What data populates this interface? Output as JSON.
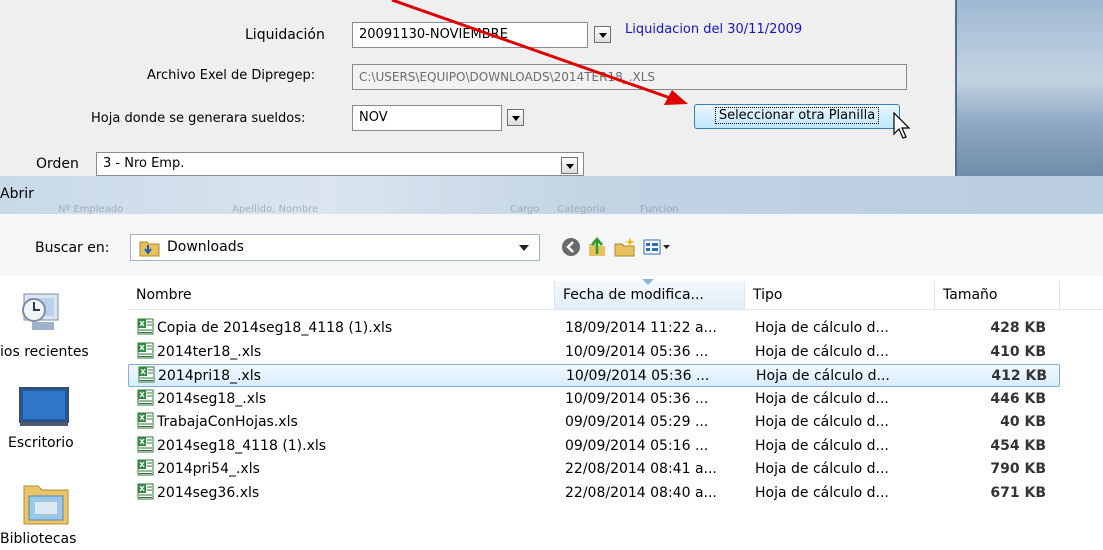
{
  "form": {
    "liquidacion_label": "Liquidación",
    "liquidacion_value": "20091130-NOVIEMBRE",
    "liquidacion_info": "Liquidacion del 30/11/2009",
    "archivo_label": "Archivo Exel de Dipregep:",
    "archivo_value": "C:\\USERS\\EQUIPO\\DOWNLOADS\\2014TER18_.XLS",
    "hoja_label": "Hoja donde se generara sueldos:",
    "hoja_value": "NOV",
    "select_button": "Seleccionar otra Planilla",
    "orden_label": "Orden",
    "orden_value": "3 - Nro Emp."
  },
  "dialog": {
    "title": "Abrir",
    "ghost_headers": [
      "Nº Empleado",
      "Apellido, Nombre",
      "Cargo",
      "Categoria",
      "Funcion"
    ],
    "buscar_label": "Buscar en:",
    "location": "Downloads",
    "places": [
      "ios recientes",
      "Escritorio",
      "Bibliotecas"
    ],
    "columns": [
      "Nombre",
      "Fecha de modifica...",
      "Tipo",
      "Tamaño"
    ],
    "files": [
      {
        "name": "Copia de 2014seg18_4118 (1).xls",
        "date": "18/09/2014 11:22 a...",
        "type": "Hoja de cálculo d...",
        "size": "428 KB"
      },
      {
        "name": "2014ter18_.xls",
        "date": "10/09/2014 05:36 ...",
        "type": "Hoja de cálculo d...",
        "size": "410 KB"
      },
      {
        "name": "2014pri18_.xls",
        "date": "10/09/2014 05:36 ...",
        "type": "Hoja de cálculo d...",
        "size": "412 KB"
      },
      {
        "name": "2014seg18_.xls",
        "date": "10/09/2014 05:36 ...",
        "type": "Hoja de cálculo d...",
        "size": "446 KB"
      },
      {
        "name": "TrabajaConHojas.xls",
        "date": "09/09/2014 05:29 ...",
        "type": "Hoja de cálculo d...",
        "size": "40 KB"
      },
      {
        "name": "2014seg18_4118 (1).xls",
        "date": "09/09/2014 05:16 ...",
        "type": "Hoja de cálculo d...",
        "size": "454 KB"
      },
      {
        "name": "2014pri54_.xls",
        "date": "22/08/2014 08:41 a...",
        "type": "Hoja de cálculo d...",
        "size": "790 KB"
      },
      {
        "name": "2014seg36.xls",
        "date": "22/08/2014 08:40 a...",
        "type": "Hoja de cálculo d...",
        "size": "671 KB"
      }
    ],
    "selected_index": 2
  },
  "colors": {
    "link_blue": "#1515c8",
    "annotation_arrow": "#e00000",
    "selection_border": "#84acdd"
  }
}
